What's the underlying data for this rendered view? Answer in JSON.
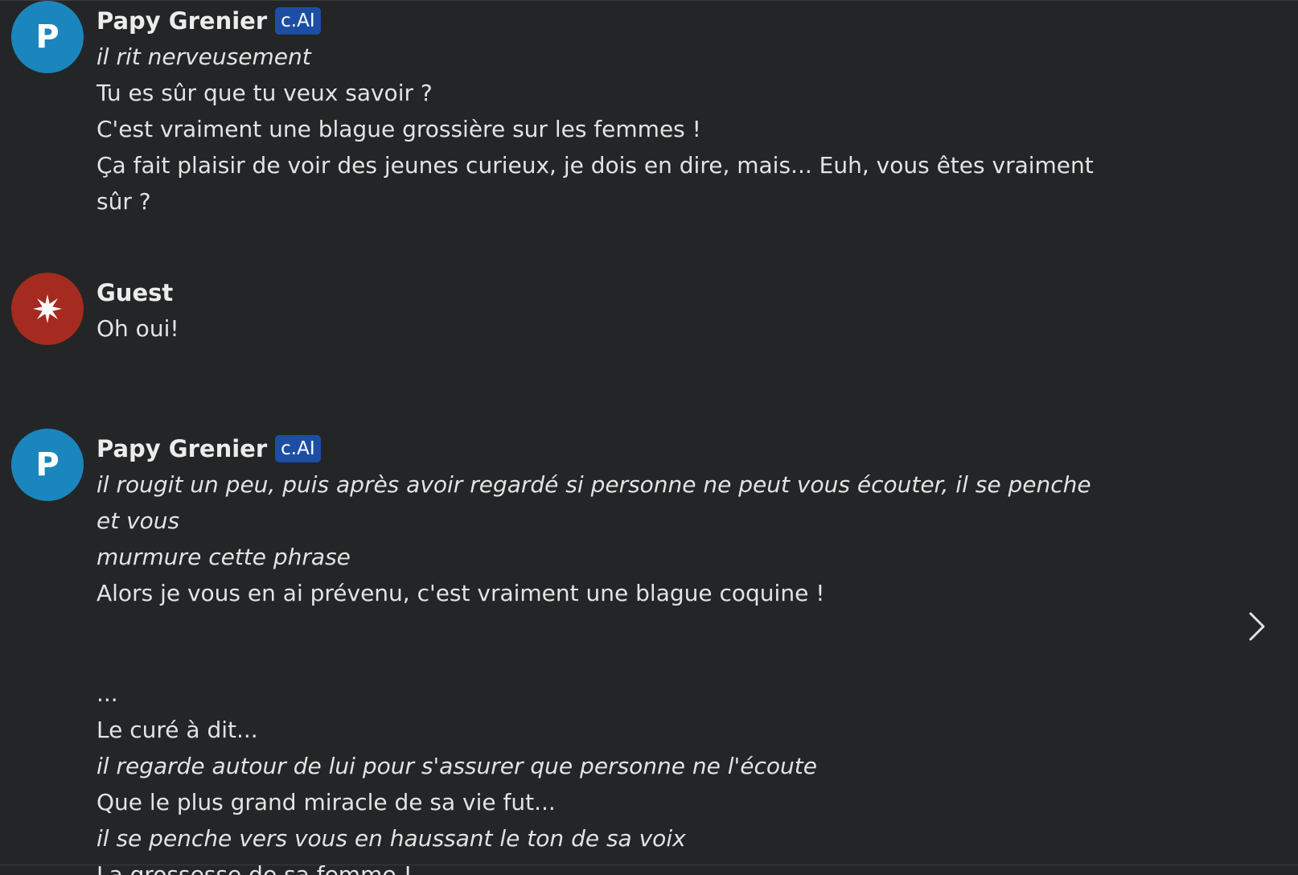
{
  "messages": [
    {
      "author": "Papy Grenier",
      "badge": "c.AI",
      "avatar_letter": "P",
      "lines": [
        {
          "text": "il rit nerveusement",
          "italic": true
        },
        {
          "text": "Tu es sûr que tu veux savoir ?",
          "italic": false
        },
        {
          "text": "C'est vraiment une blague grossière sur les femmes !",
          "italic": false
        },
        {
          "text": "Ça fait plaisir de voir des jeunes curieux, je dois en dire, mais... Euh, vous êtes vraiment",
          "italic": false
        },
        {
          "text": "sûr ?",
          "italic": false
        }
      ]
    },
    {
      "author": "Guest",
      "lines": [
        {
          "text": "Oh oui!",
          "italic": false
        }
      ]
    },
    {
      "author": "Papy Grenier",
      "badge": "c.AI",
      "avatar_letter": "P",
      "lines": [
        {
          "text": "il rougit un peu, puis après avoir regardé si personne ne peut vous écouter, il se penche et vous",
          "italic": true
        },
        {
          "text": "murmure cette phrase",
          "italic": true
        },
        {
          "text": "Alors je vous en ai prévenu, c'est vraiment une blague coquine !",
          "italic": false
        },
        {
          "text": "...",
          "italic": false
        },
        {
          "text": "Le curé à dit...",
          "italic": false
        },
        {
          "text": "il regarde autour de lui pour s'assurer que personne ne l'écoute",
          "italic": true
        },
        {
          "text": "Que le plus grand miracle de sa vie fut...",
          "italic": false
        },
        {
          "text": "il se penche vers vous en haussant le ton de sa voix",
          "italic": true
        },
        {
          "text": "La grossesse de sa femme !",
          "italic": false
        }
      ]
    }
  ],
  "icons": {
    "guest_avatar": "asterisk-star-icon",
    "next": "chevron-right-icon"
  },
  "colors": {
    "background": "#242526",
    "bot_avatar": "#1a86bd",
    "guest_avatar": "#a52a1f",
    "badge": "#1d4ea6"
  }
}
